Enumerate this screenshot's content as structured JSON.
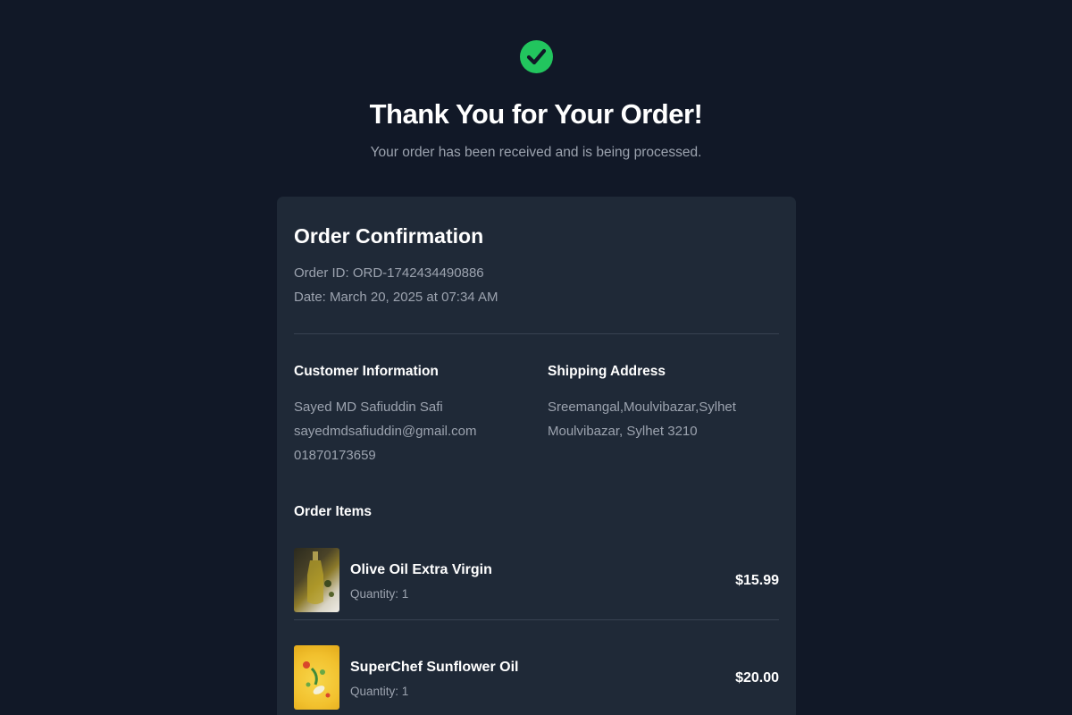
{
  "header": {
    "icon": "check-circle-icon",
    "success_color": "#22c55e",
    "title": "Thank You for Your Order!",
    "subtitle": "Your order has been received and is being processed."
  },
  "order": {
    "title": "Order Confirmation",
    "id_line": "Order ID: ORD-1742434490886",
    "date_line": "Date: March 20, 2025 at 07:34 AM"
  },
  "customer": {
    "heading": "Customer Information",
    "name": "Sayed MD Safiuddin Safi",
    "email": "sayedmdsafiuddin@gmail.com",
    "phone": "01870173659"
  },
  "shipping": {
    "heading": "Shipping Address",
    "line1": "Sreemangal,Moulvibazar,Sylhet",
    "line2": "Moulvibazar, Sylhet 3210"
  },
  "items": {
    "heading": "Order Items",
    "list": [
      {
        "name": "Olive Oil Extra Virgin",
        "quantity": "Quantity: 1",
        "price": "$15.99"
      },
      {
        "name": "SuperChef Sunflower Oil",
        "quantity": "Quantity: 1",
        "price": "$20.00"
      }
    ]
  },
  "colors": {
    "page_bg": "#111827",
    "card_bg": "#1f2937",
    "muted_text": "#9ca3af",
    "divider": "#374151"
  }
}
